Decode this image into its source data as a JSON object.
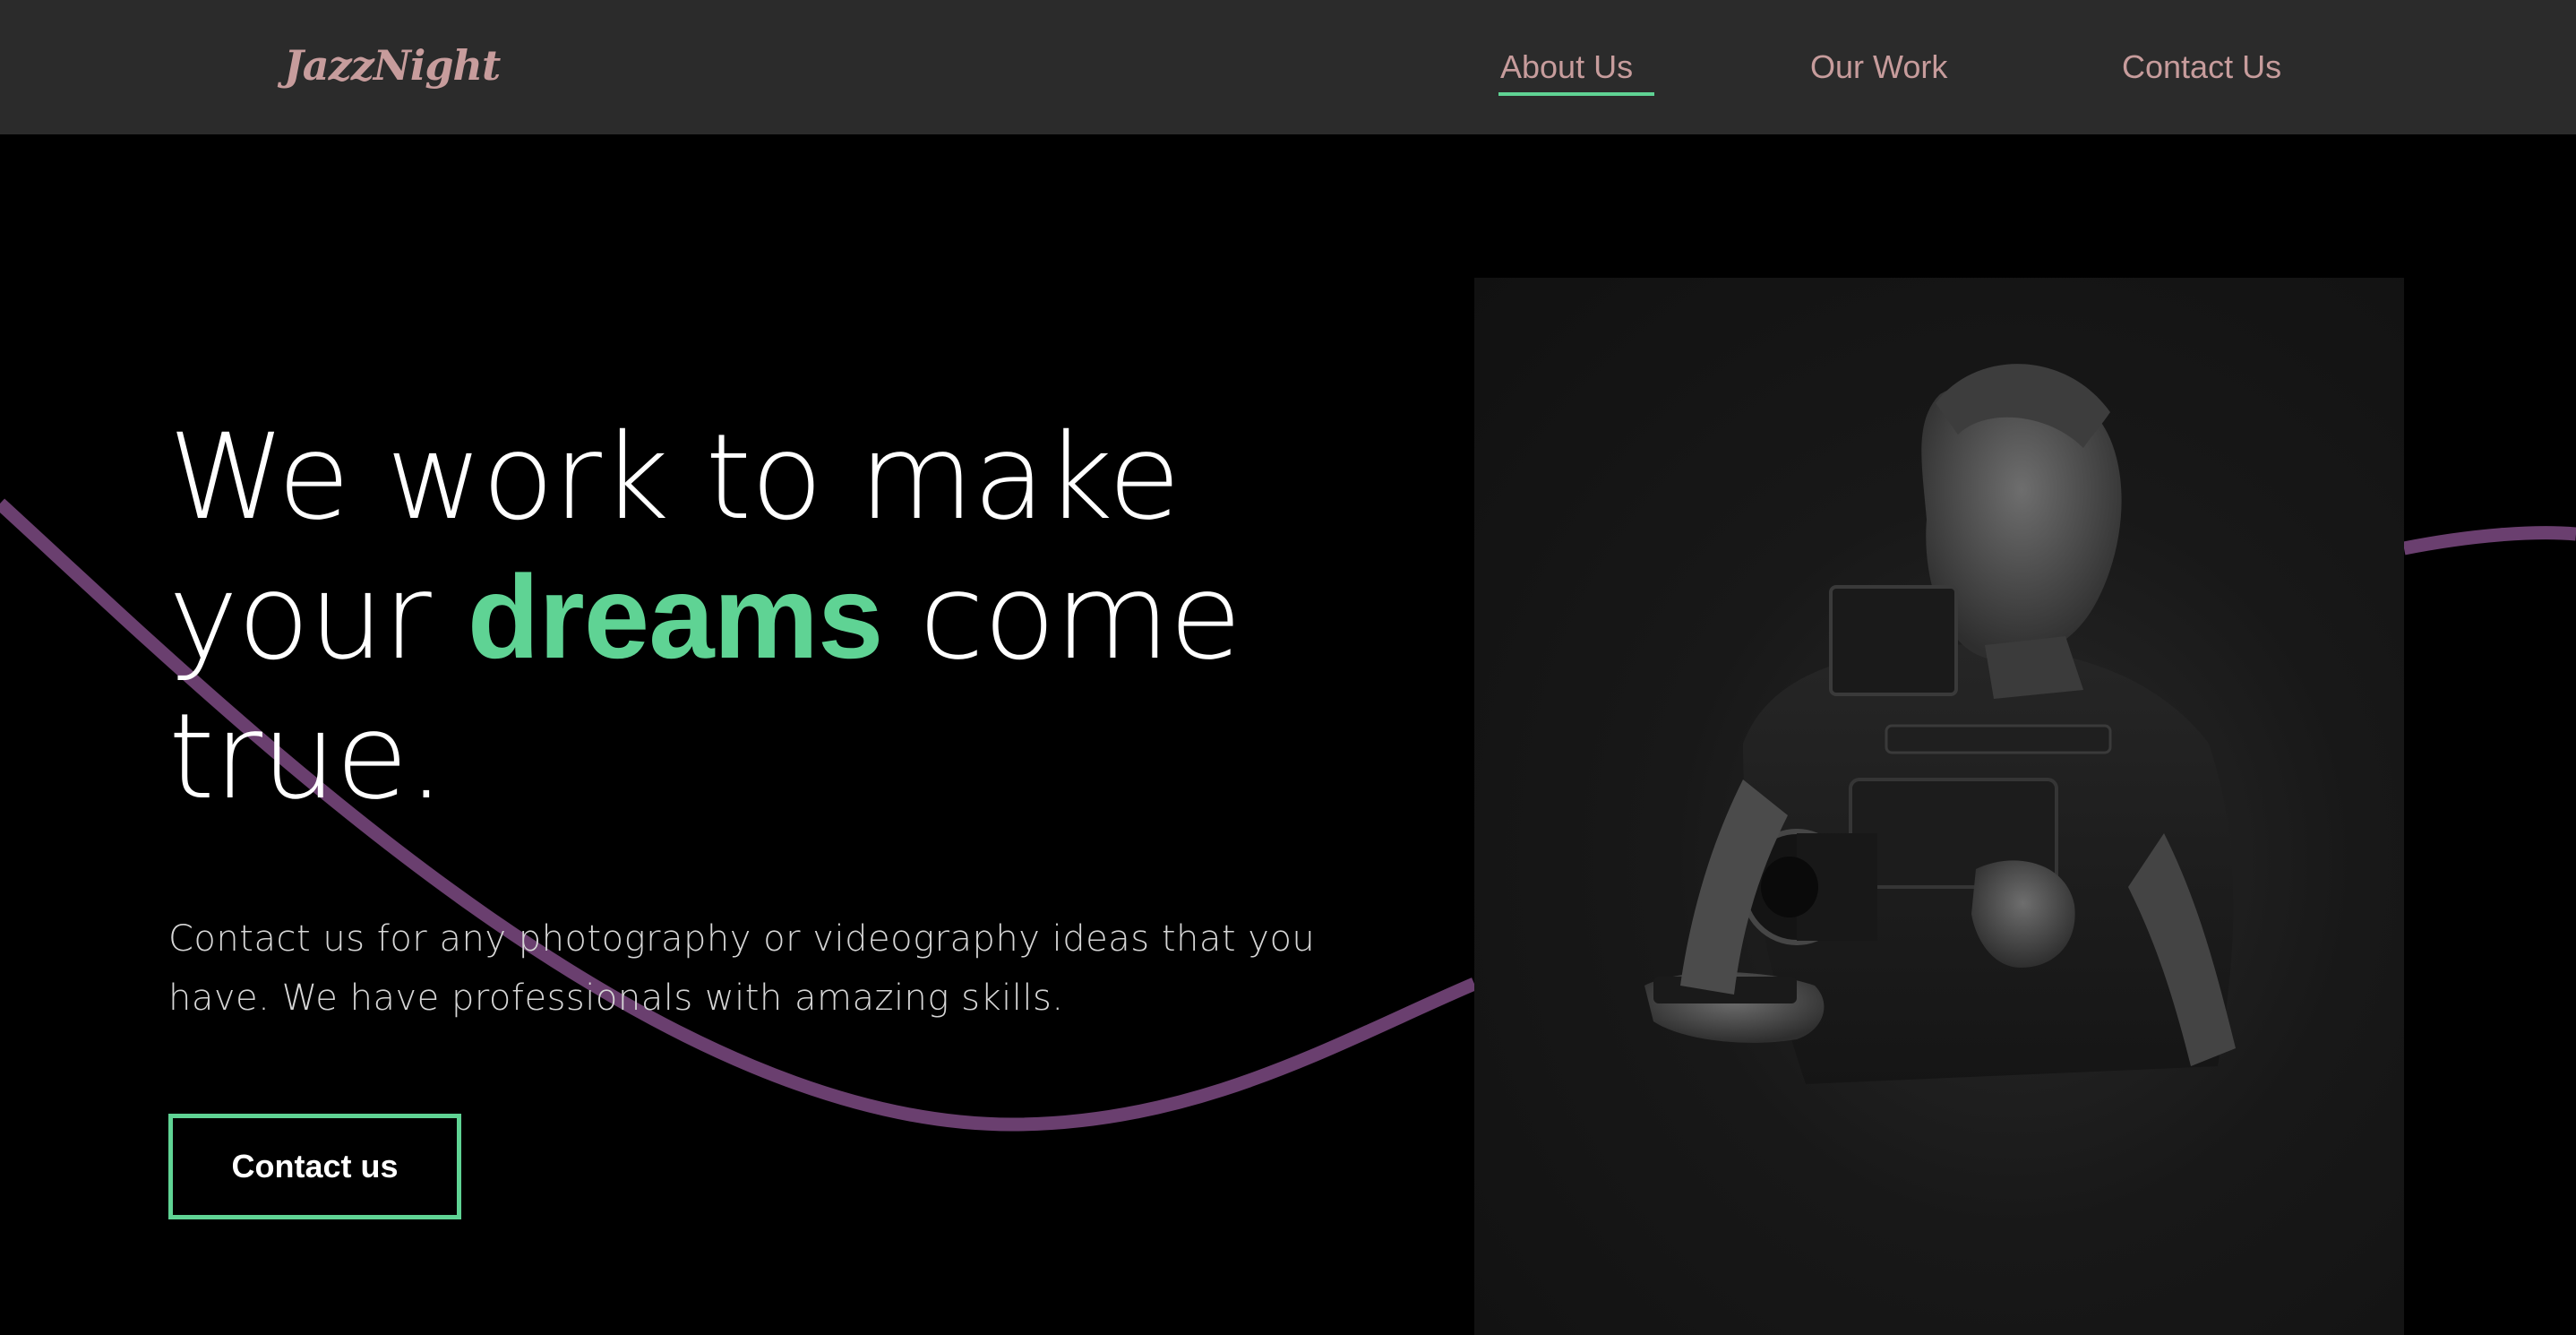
{
  "navbar": {
    "logo": "JazzNight",
    "links": [
      {
        "label": "About Us",
        "active": true
      },
      {
        "label": "Our Work",
        "active": false
      },
      {
        "label": "Contact Us",
        "active": false
      }
    ]
  },
  "hero": {
    "headline": {
      "part1": "We work to make",
      "part2": "your ",
      "accent": "dreams",
      "part3": " come",
      "part4": "true."
    },
    "subtext": "Contact us for any photography or videography ideas that you have. We have professionals with amazing skills.",
    "cta_label": "Contact us",
    "image": {
      "description_icon": "photographer-with-camera-rig",
      "style": "black-and-white"
    }
  },
  "colors": {
    "background": "#000000",
    "navbar": "#2b2b2b",
    "nav_text": "#c79c9c",
    "accent_green": "#5fd394",
    "wave_purple": "#6a3f6f",
    "text": "#ffffff"
  }
}
